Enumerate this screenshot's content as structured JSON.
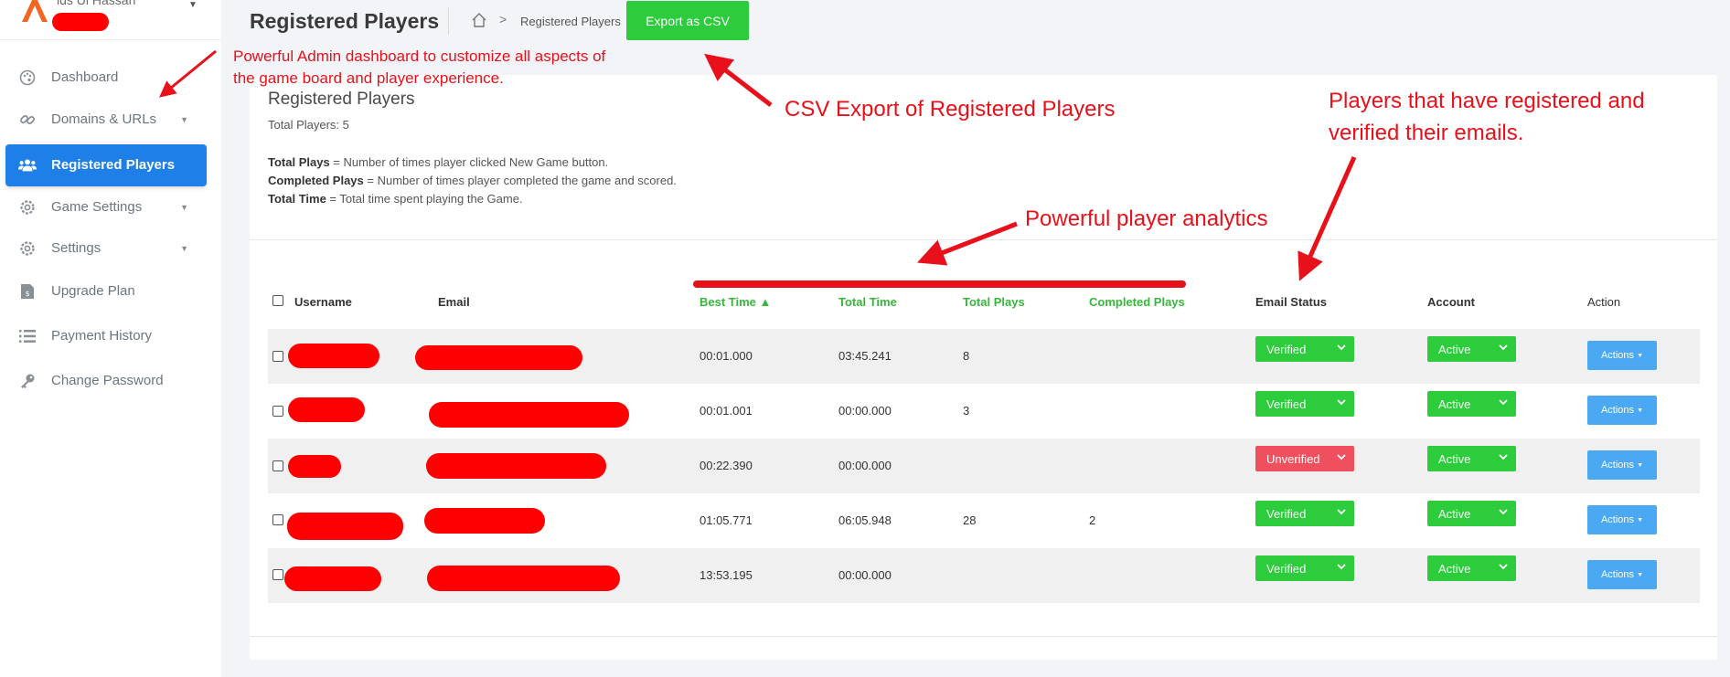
{
  "sidebar": {
    "profile": {
      "name": "ids Ul Hassan"
    },
    "items": [
      {
        "label": "Dashboard",
        "icon": "palette-icon"
      },
      {
        "label": "Domains & URLs",
        "icon": "link-icon"
      },
      {
        "label": "Registered Players",
        "icon": "users-icon"
      },
      {
        "label": "Game Settings",
        "icon": "gear-icon"
      },
      {
        "label": "Settings",
        "icon": "gear-icon"
      },
      {
        "label": "Upgrade Plan",
        "icon": "invoice-icon"
      },
      {
        "label": "Payment History",
        "icon": "list-icon"
      },
      {
        "label": "Change Password",
        "icon": "key-icon"
      }
    ]
  },
  "header": {
    "title": "Registered Players",
    "breadcrumb_current": "Registered Players",
    "export_label": "Export as CSV"
  },
  "card": {
    "title": "Registered Players",
    "total_players": "Total Players: 5",
    "definitions": [
      {
        "term": "Total Plays",
        "text": " = Number of times player clicked New Game button."
      },
      {
        "term": "Completed Plays",
        "text": " = Number of times player completed the game and scored."
      },
      {
        "term": "Total Time",
        "text": " = Total time spent playing the Game."
      }
    ]
  },
  "table": {
    "headers": {
      "username": "Username",
      "email": "Email",
      "best_time": "Best Time ▲",
      "total_time": "Total Time",
      "total_plays": "Total Plays",
      "completed_plays": "Completed Plays",
      "email_status": "Email Status",
      "account": "Account",
      "action": "Action"
    },
    "rows": [
      {
        "best_time": "00:01.000",
        "total_time": "03:45.241",
        "total_plays": "8",
        "completed_plays": "",
        "email_status": "Verified",
        "account": "Active",
        "action": "Actions"
      },
      {
        "best_time": "00:01.001",
        "total_time": "00:00.000",
        "total_plays": "3",
        "completed_plays": "",
        "email_status": "Verified",
        "account": "Active",
        "action": "Actions"
      },
      {
        "best_time": "00:22.390",
        "total_time": "00:00.000",
        "total_plays": "",
        "completed_plays": "",
        "email_status": "Unverified",
        "account": "Active",
        "action": "Actions"
      },
      {
        "best_time": "01:05.771",
        "total_time": "06:05.948",
        "total_plays": "28",
        "completed_plays": "2",
        "email_status": "Verified",
        "account": "Active",
        "action": "Actions"
      },
      {
        "best_time": "13:53.195",
        "total_time": "00:00.000",
        "total_plays": "",
        "completed_plays": "",
        "email_status": "Verified",
        "account": "Active",
        "action": "Actions"
      }
    ]
  },
  "annotations": {
    "admin": [
      "Powerful Admin dashboard to customize all aspects of",
      "the game board and player experience."
    ],
    "csv": "CSV Export of Registered Players",
    "players": [
      "Players that have registered and",
      "verified their emails."
    ],
    "analytics": "Powerful player analytics"
  },
  "colors": {
    "accent_blue": "#1f7fe8",
    "success_green": "#2dcc3d",
    "danger_red": "#f0505e",
    "action_blue": "#4aa9f2",
    "annotation_red": "#e8101a"
  }
}
